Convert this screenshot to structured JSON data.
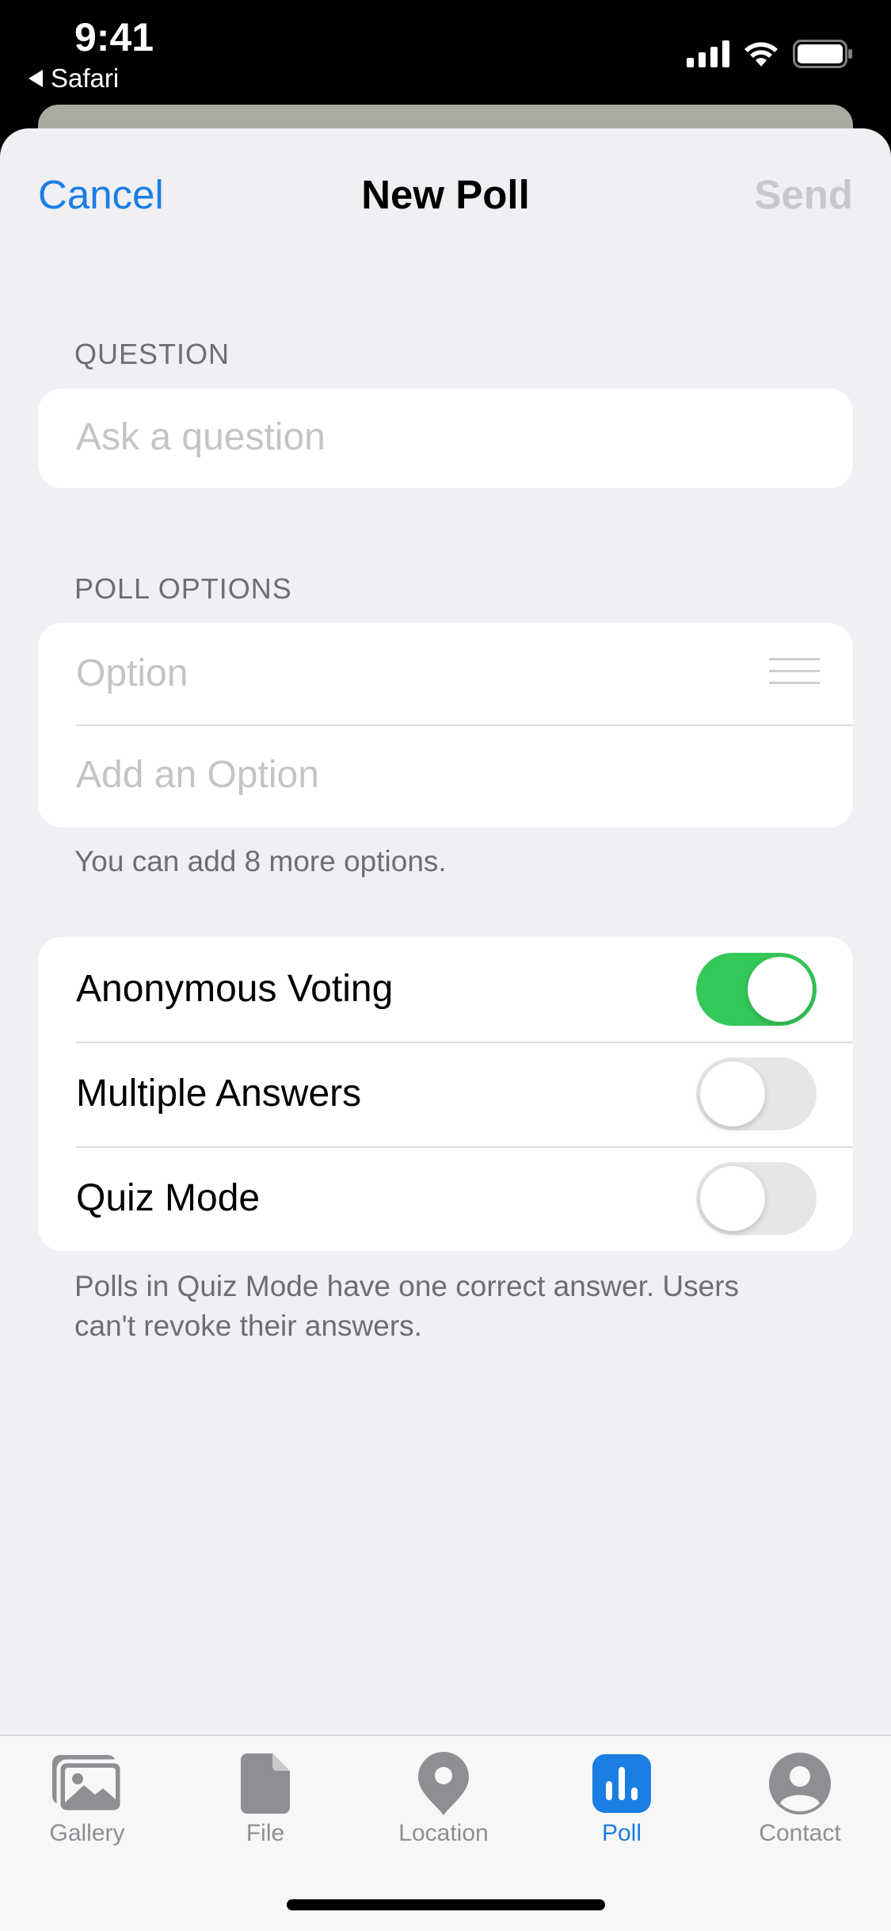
{
  "status_bar": {
    "time": "9:41",
    "back_app": "Safari"
  },
  "nav": {
    "cancel": "Cancel",
    "title": "New Poll",
    "send": "Send"
  },
  "question": {
    "label": "QUESTION",
    "placeholder": "Ask a question"
  },
  "poll_options": {
    "label": "POLL OPTIONS",
    "option_placeholder": "Option",
    "add_placeholder": "Add an Option",
    "footnote": "You can add 8 more options."
  },
  "settings": {
    "rows": [
      {
        "label": "Anonymous Voting",
        "on": true
      },
      {
        "label": "Multiple Answers",
        "on": false
      },
      {
        "label": "Quiz Mode",
        "on": false
      }
    ],
    "footnote_line1": "Polls in Quiz Mode have one correct answer. Users",
    "footnote_line2": "can't revoke their answers."
  },
  "tabs": [
    {
      "label": "Gallery",
      "icon": "gallery-icon",
      "active": false
    },
    {
      "label": "File",
      "icon": "file-icon",
      "active": false
    },
    {
      "label": "Location",
      "icon": "location-pin-icon",
      "active": false
    },
    {
      "label": "Poll",
      "icon": "poll-icon",
      "active": true
    },
    {
      "label": "Contact",
      "icon": "contact-icon",
      "active": false
    }
  ],
  "colors": {
    "accent": "#1a7ee3",
    "toggle_on": "#34c759",
    "background": "#efeff4"
  }
}
